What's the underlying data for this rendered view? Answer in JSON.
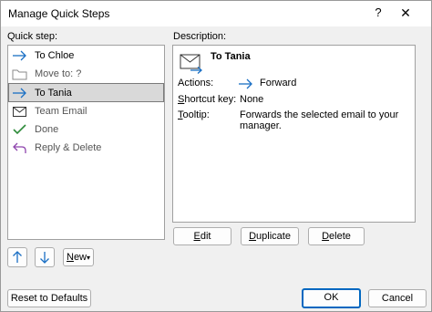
{
  "window": {
    "title": "Manage Quick Steps",
    "help": "?",
    "close": "✕"
  },
  "quick_step_label": "Quick step:",
  "description_label": "Description:",
  "quick_steps": [
    {
      "label": "To Chloe",
      "icon": "forward-arrow-icon",
      "dim": false
    },
    {
      "label": "Move to: ?",
      "icon": "folder-move-icon",
      "dim": true
    },
    {
      "label": "To Tania",
      "icon": "forward-arrow-icon",
      "dim": false,
      "selected": true
    },
    {
      "label": "Team Email",
      "icon": "envelope-icon",
      "dim": true
    },
    {
      "label": "Done",
      "icon": "checkmark-icon",
      "dim": true
    },
    {
      "label": "Reply & Delete",
      "icon": "reply-icon",
      "dim": true
    }
  ],
  "description": {
    "title": "To Tania",
    "actions_label": "Actions:",
    "action_value": "Forward",
    "shortcut_label": "Shortcut key:",
    "shortcut_value": "None",
    "tooltip_label": "Tooltip:",
    "tooltip_line1": "Forwards the selected email to your",
    "tooltip_line2": "manager."
  },
  "buttons": {
    "edit": "Edit",
    "duplicate": "Duplicate",
    "delete": "Delete",
    "new": "New",
    "reset": "Reset to Defaults",
    "ok": "OK",
    "cancel": "Cancel"
  }
}
